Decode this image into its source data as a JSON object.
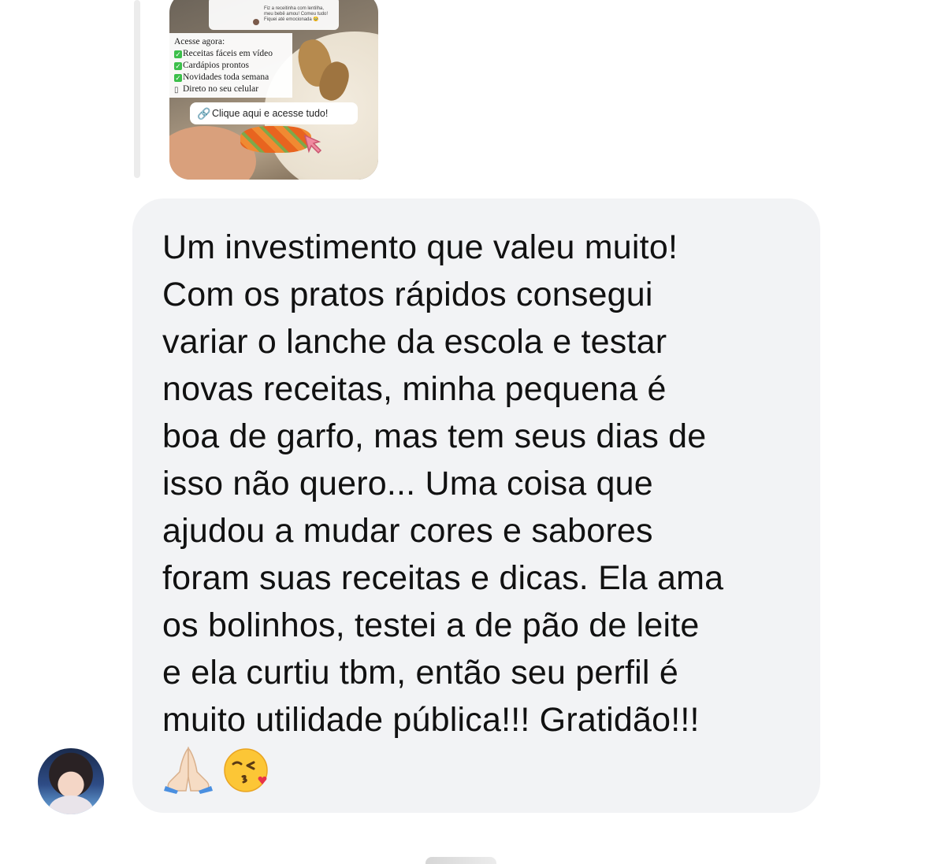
{
  "story_reply": {
    "top_card_text": "Fiz a receitinha com lentilha, meu bebê amou! Comeu tudo! Fiquei até emocionada 🥹",
    "list_title": "Acesse agora:",
    "list_items": [
      {
        "icon": "check-icon",
        "text": "Receitas fáceis em vídeo"
      },
      {
        "icon": "check-icon",
        "text": "Cardápios prontos"
      },
      {
        "icon": "check-icon",
        "text": "Novidades toda semana"
      },
      {
        "icon": "phone-icon",
        "text": "Direto no seu celular"
      }
    ],
    "link_label": "Clique aqui e acesse tudo!"
  },
  "message": {
    "text": "Um investimento que valeu muito!\nCom os pratos rápidos consegui\nvariar o lanche da escola e testar\nnovas receitas, minha pequena é\nboa de garfo, mas tem seus dias de\nisso não quero... Uma coisa que\najudou a mudar cores e sabores\nforam suas receitas e dicas. Ela ama\nos bolinhos, testei a de pão de leite\ne ela curtiu tbm, então seu perfil é\nmuito utilidade pública!!! Gratidão!!!",
    "emoji_1": "🙏🏻",
    "emoji_2": "😘"
  },
  "colors": {
    "bubble": "#f2f3f5",
    "text": "#111111",
    "check": "#3cbf4a",
    "link_icon": "#4a90d9"
  }
}
